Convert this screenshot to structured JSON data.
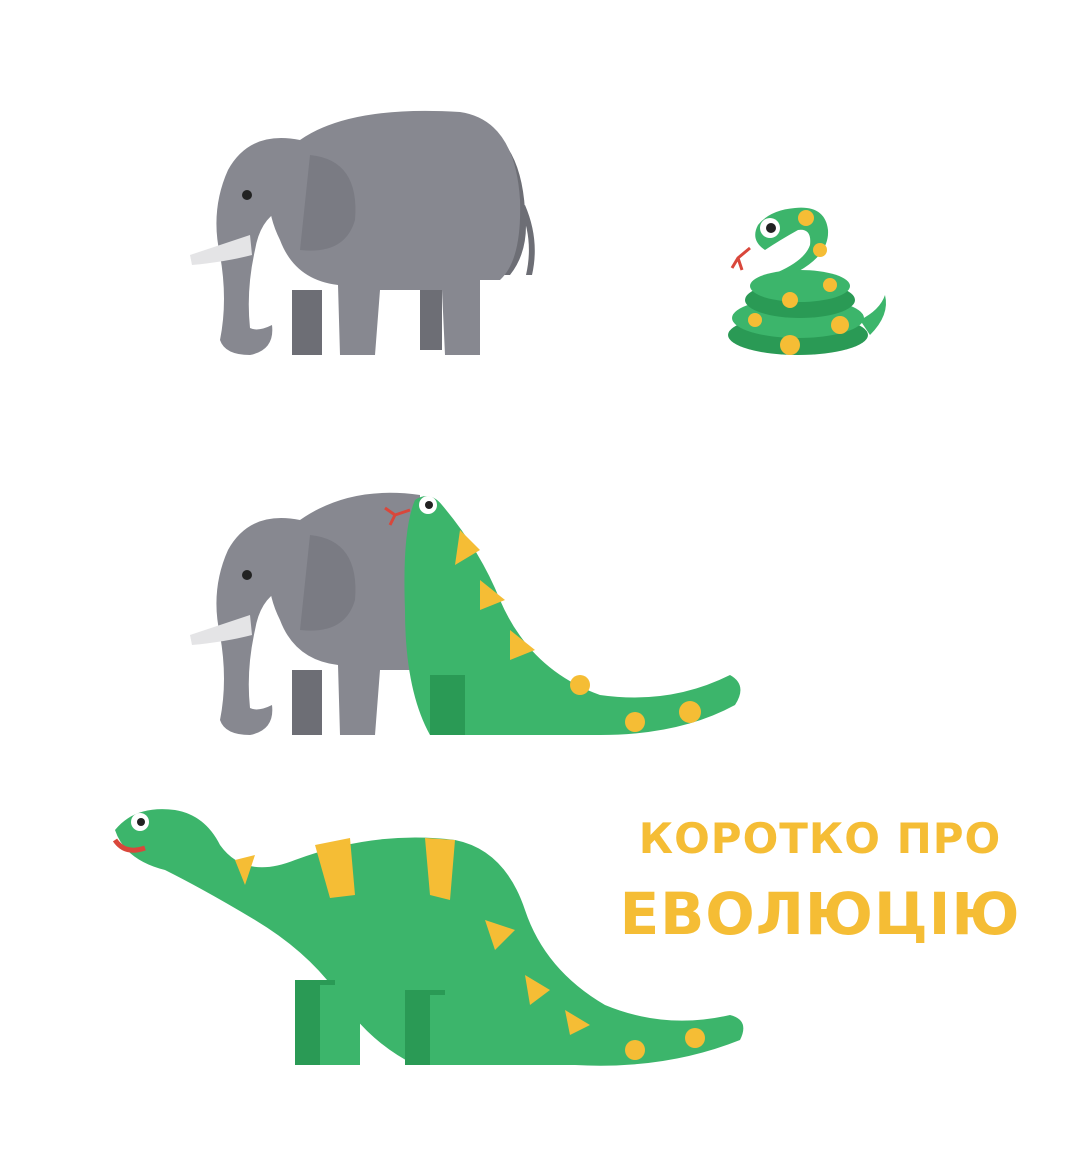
{
  "caption": {
    "line1": "КОРОТКО ПРО",
    "line2": "ЕВОЛЮЦІЮ"
  },
  "colors": {
    "background": "#ffffff",
    "elephant_body": "#878890",
    "elephant_shadow": "#6d6e75",
    "tusk": "#e4e4e6",
    "snake_green": "#3cb56b",
    "snake_dark": "#2a9a55",
    "spots_yellow": "#f5bd35",
    "tongue_red": "#d9473b",
    "caption_text": "#f5bd35"
  },
  "icons": [
    "elephant-icon",
    "coiled-snake-icon",
    "elephant-swallowed-by-snake-icon",
    "dinosaur-icon"
  ]
}
